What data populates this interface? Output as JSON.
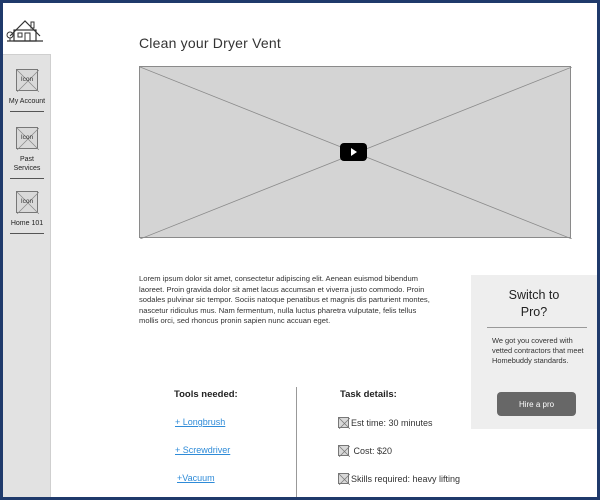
{
  "sidebar": {
    "items": [
      {
        "icon_text": "Icon",
        "label": "My Account",
        "icon": "placeholder-icon"
      },
      {
        "icon_text": "Icon",
        "label": "Past Services",
        "icon": "placeholder-icon"
      },
      {
        "icon_text": "Icon",
        "label": "Home 101",
        "icon": "placeholder-icon"
      }
    ],
    "logo_icon": "house-logo-icon"
  },
  "main": {
    "title": "Clean your Dryer Vent",
    "video": {
      "play_icon": "play-icon"
    },
    "body_text": "Lorem ipsum dolor sit amet, consectetur adipiscing elit. Aenean euismod bibendum laoreet. Proin gravida dolor sit amet lacus accumsan et viverra justo commodo. Proin sodales pulvinar sic tempor. Sociis natoque penatibus et magnis dis parturient montes, nascetur ridiculus mus. Nam fermentum, nulla luctus pharetra vulputate, felis tellus mollis orci, sed rhoncus pronin sapien nunc accuan eget."
  },
  "promo": {
    "title": "Switch to Pro?",
    "text": "We got you covered with vetted contractors that meet Homebuddy standards.",
    "button_label": "Hire a pro"
  },
  "tools": {
    "heading": "Tools needed:",
    "items": [
      "+ Longbrush",
      "+ Screwdriver",
      "+Vacuum"
    ]
  },
  "task": {
    "heading": "Task details:",
    "items": [
      "Est time: 30 minutes",
      " Cost: $20",
      "Skills required: heavy lifting"
    ]
  },
  "colors": {
    "frame_border": "#1f3a6b",
    "sidebar_bg": "#e2e2e2",
    "link": "#2e8bd8",
    "button_bg": "#676767"
  }
}
